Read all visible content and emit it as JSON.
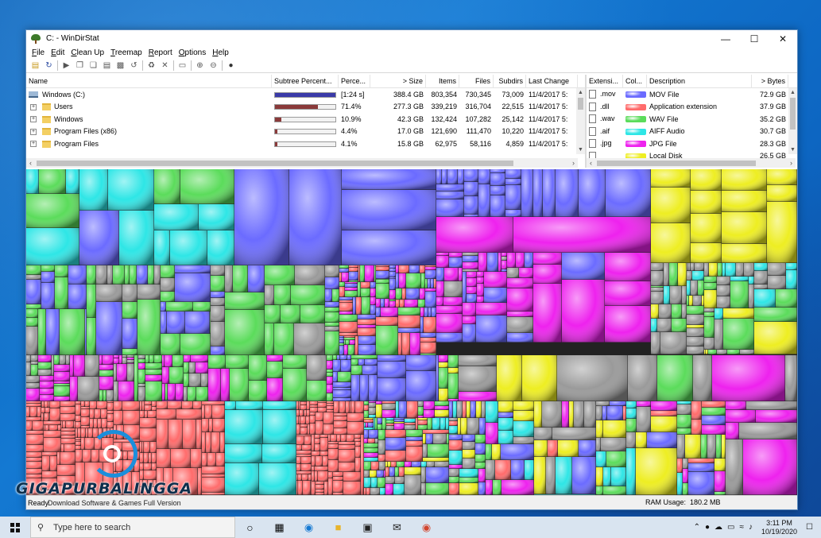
{
  "window": {
    "title": "C: - WinDirStat",
    "controls": {
      "minimize": "—",
      "maximize": "☐",
      "close": "✕"
    }
  },
  "menu": [
    "File",
    "Edit",
    "Clean Up",
    "Treemap",
    "Report",
    "Options",
    "Help"
  ],
  "toolbar_icons": [
    "open-icon",
    "refresh-icon",
    "sep",
    "play-icon",
    "copy-icon",
    "copy-path-icon",
    "explorer-icon",
    "cmd-icon",
    "refresh-selected-icon",
    "sep",
    "recycle-icon",
    "delete-icon",
    "sep",
    "properties-icon",
    "sep",
    "zoom-in-icon",
    "zoom-out-icon",
    "sep",
    "help-icon"
  ],
  "dir_table": {
    "headers": [
      "Name",
      "Subtree Percent...",
      "Perce...",
      "> Size",
      "Items",
      "Files",
      "Subdirs",
      "Last Change"
    ],
    "rows": [
      {
        "name": "Windows (C:)",
        "percent_bar": 100,
        "bar_color": "#3a3aa8",
        "percent": "[1:24 s]",
        "size": "388.4 GB",
        "items": "803,354",
        "files": "730,345",
        "subdirs": "73,009",
        "last_change": "11/4/2017  5:"
      },
      {
        "name": "Users",
        "percent_bar": 71.4,
        "bar_color": "#8a3a3a",
        "percent": "71.4%",
        "size": "277.3 GB",
        "items": "339,219",
        "files": "316,704",
        "subdirs": "22,515",
        "last_change": "11/4/2017  5:"
      },
      {
        "name": "Windows",
        "percent_bar": 10.9,
        "bar_color": "#8a3a3a",
        "percent": "10.9%",
        "size": "42.3 GB",
        "items": "132,424",
        "files": "107,282",
        "subdirs": "25,142",
        "last_change": "11/4/2017  5:"
      },
      {
        "name": "Program Files (x86)",
        "percent_bar": 4.4,
        "bar_color": "#8a3a3a",
        "percent": "4.4%",
        "size": "17.0 GB",
        "items": "121,690",
        "files": "111,470",
        "subdirs": "10,220",
        "last_change": "11/4/2017  5:"
      },
      {
        "name": "Program Files",
        "percent_bar": 4.1,
        "bar_color": "#8a3a3a",
        "percent": "4.1%",
        "size": "15.8 GB",
        "items": "62,975",
        "files": "58,116",
        "subdirs": "4,859",
        "last_change": "11/4/2017  5:"
      }
    ]
  },
  "ext_table": {
    "headers": [
      "Extensi...",
      "Col...",
      "Description",
      "> Bytes"
    ],
    "rows": [
      {
        "ext": ".mov",
        "color": "#6b6bff",
        "desc": "MOV File",
        "bytes": "72.9 GB"
      },
      {
        "ext": ".dll",
        "color": "#ff6b6b",
        "desc": "Application extension",
        "bytes": "37.9 GB"
      },
      {
        "ext": ".wav",
        "color": "#5bdc5b",
        "desc": "WAV File",
        "bytes": "35.2 GB"
      },
      {
        "ext": ".aif",
        "color": "#2ee6e6",
        "desc": "AIFF Audio",
        "bytes": "30.7 GB"
      },
      {
        "ext": ".jpg",
        "color": "#ee22ee",
        "desc": "JPG File",
        "bytes": "28.3 GB"
      },
      {
        "ext": "",
        "color": "#eeee22",
        "desc": "Local Disk",
        "bytes": "26.5 GB"
      }
    ]
  },
  "status": {
    "ready": "Ready",
    "ram_label": "RAM Usage:",
    "ram_value": "180.2 MB"
  },
  "watermark": {
    "brand": "GIGAPURBALINGGA",
    "tagline": "Download Software & Games Full Version"
  },
  "taskbar": {
    "search_placeholder": "Type here to search",
    "apps": [
      "cortana-icon",
      "task-view-icon",
      "edge-icon",
      "file-explorer-icon",
      "store-icon",
      "mail-icon",
      "chrome-icon"
    ],
    "time": "3:11 PM",
    "date": "10/19/2020"
  },
  "treemap_colors": {
    "mov": "#6b6bff",
    "dll": "#ff6b6b",
    "wav": "#5bdc5b",
    "aif": "#2ee6e6",
    "jpg": "#ee22ee",
    "disk": "#eeee22",
    "other": "#9a9a9a"
  }
}
